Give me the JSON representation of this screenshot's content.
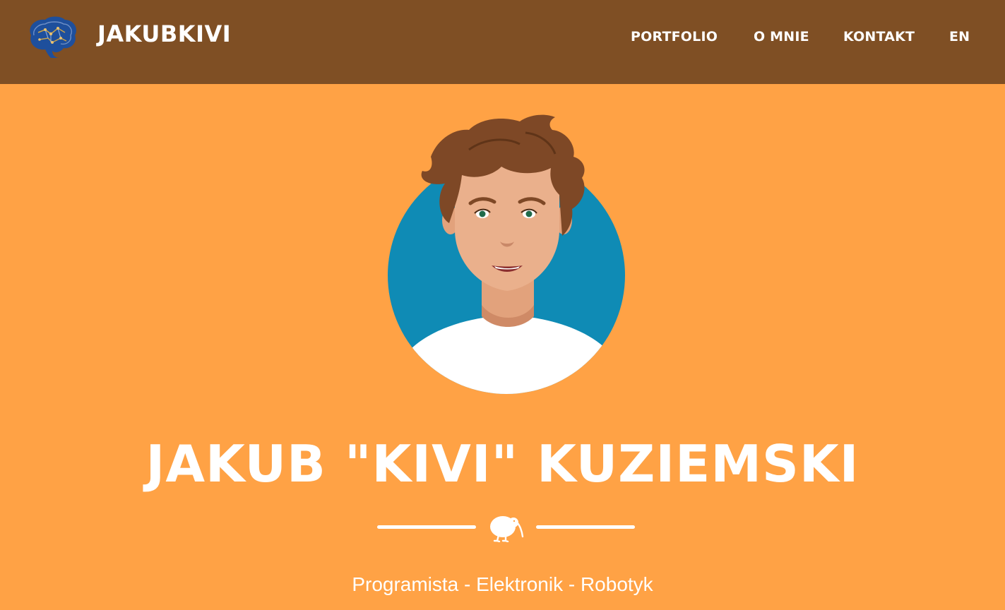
{
  "brand": {
    "name": "JAKUBKIVI",
    "logo_icon": "brain-circuit-icon"
  },
  "nav": {
    "items": [
      {
        "label": "PORTFOLIO"
      },
      {
        "label": "O MNIE"
      },
      {
        "label": "KONTAKT"
      },
      {
        "label": "EN"
      }
    ]
  },
  "masthead": {
    "avatar_icon": "avatar-illustration",
    "heading": "JAKUB \"KIVI\" KUZIEMSKI",
    "divider_icon": "kiwi-bird-icon",
    "subheading": "Programista - Elektronik - Robotyk"
  },
  "colors": {
    "navbar": "#7f4f24",
    "background": "#ffa245",
    "avatar_circle": "#0f8bb5",
    "text": "#ffffff"
  }
}
